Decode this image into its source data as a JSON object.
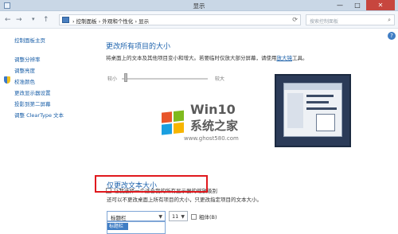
{
  "window": {
    "title": "显示",
    "buttons": {
      "minimize": "—",
      "maximize": "□",
      "close": "✕"
    }
  },
  "navbar": {
    "back": "←",
    "forward": "→",
    "up": "↑",
    "dropdown": "▾",
    "breadcrumb": "› 控制面板 › 外观和个性化 › 显示",
    "search_placeholder": "搜索控制面板",
    "search_icon": "⌕",
    "refresh": "⟳"
  },
  "sidebar": {
    "home": "控制面板主页",
    "items": [
      "调整分辨率",
      "调整亮度",
      "校准颜色",
      "更改显示器设置",
      "投影到第二屏幕",
      "调整 ClearType 文本"
    ]
  },
  "main": {
    "heading1": "更改所有项目的大小",
    "desc1_prefix": "将桌面上的文本及其他项目变小和增大。若要临时仅放大部分屏幕，请使用",
    "desc1_link": "放大镜",
    "desc1_suffix": "工具。",
    "slider_min": "较小",
    "slider_max": "较大",
    "checkbox_label": "让我选择一个适合我的所有显示器的缩放级别",
    "heading2": "仅更改文本大小",
    "desc2": "还可以不更改桌面上所有项目的大小，只更改指定项目的文本大小。",
    "item_select_value": "标题栏",
    "item_select_option": "标题栏",
    "size_select_value": "11",
    "bold_label": "粗体(B)",
    "help": "?"
  },
  "watermark": {
    "line1": "Win10",
    "line2": "系统之家",
    "url": "www.ghost580.com"
  },
  "colors": {
    "accent": "#1e63ad",
    "link": "#1a5fa8",
    "highlight_box": "#e0191e"
  }
}
